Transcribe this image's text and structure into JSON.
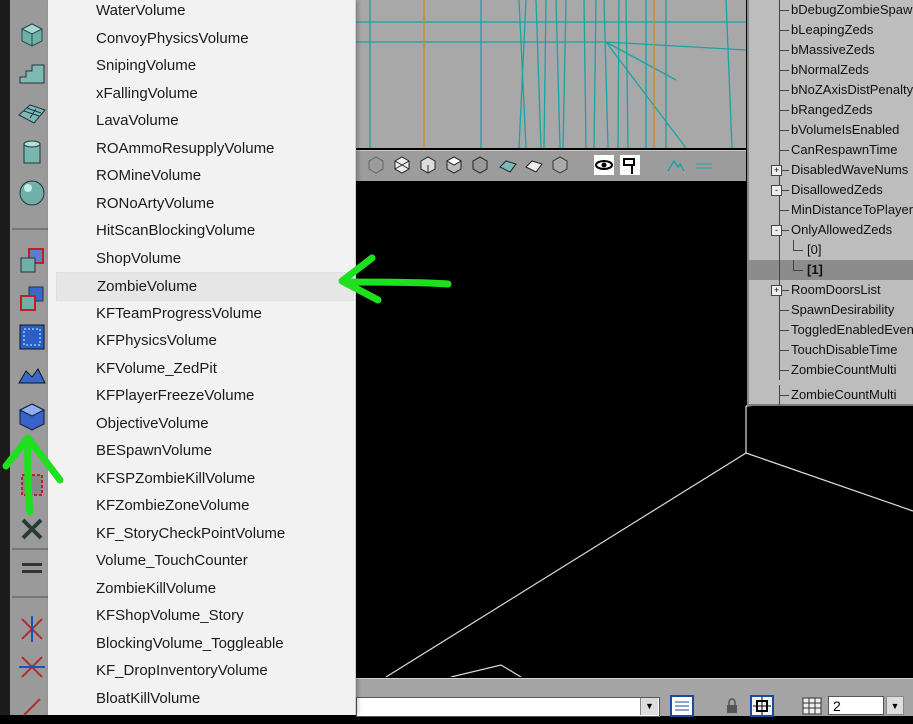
{
  "menu": {
    "items": [
      "WaterVolume",
      "ConvoyPhysicsVolume",
      "SnipingVolume",
      "xFallingVolume",
      "LavaVolume",
      "ROAmmoResupplyVolume",
      "ROMineVolume",
      "RONoArtyVolume",
      "HitScanBlockingVolume",
      "ShopVolume",
      "ZombieVolume",
      "KFTeamProgressVolume",
      "KFPhysicsVolume",
      "KFVolume_ZedPit",
      "KFPlayerFreezeVolume",
      "ObjectiveVolume",
      "BESpawnVolume",
      "KFSPZombieKillVolume",
      "KFZombieZoneVolume",
      "KF_StoryCheckPointVolume",
      "Volume_TouchCounter",
      "ZombieKillVolume",
      "KFShopVolume_Story",
      "BlockingVolume_Toggleable",
      "KF_DropInventoryVolume",
      "BloatKillVolume"
    ],
    "highlighted_index": 10
  },
  "properties": {
    "rows": [
      {
        "label": "bDebugZombieSpawning",
        "indent": 0
      },
      {
        "label": "bLeapingZeds",
        "indent": 0
      },
      {
        "label": "bMassiveZeds",
        "indent": 0
      },
      {
        "label": "bNormalZeds",
        "indent": 0
      },
      {
        "label": "bNoZAxisDistPenalty",
        "indent": 0
      },
      {
        "label": "bRangedZeds",
        "indent": 0
      },
      {
        "label": "bVolumeIsEnabled",
        "indent": 0
      },
      {
        "label": "CanRespawnTime",
        "indent": 0
      },
      {
        "label": "DisabledWaveNums",
        "indent": 0,
        "expander": "+"
      },
      {
        "label": "DisallowedZeds",
        "indent": 0,
        "expander": "-"
      },
      {
        "label": "MinDistanceToPlayer",
        "indent": 0
      },
      {
        "label": "OnlyAllowedZeds",
        "indent": 0,
        "expander": "-"
      },
      {
        "label": "[0]",
        "indent": 1
      },
      {
        "label": "[1]",
        "indent": 1,
        "selected": true
      },
      {
        "label": "RoomDoorsList",
        "indent": 0,
        "expander": "+"
      },
      {
        "label": "SpawnDesirability",
        "indent": 0
      },
      {
        "label": "ToggledEnabledEvent",
        "indent": 0
      },
      {
        "label": "TouchDisableTime",
        "indent": 0
      },
      {
        "label": "ZombieCountMulti",
        "indent": 0
      },
      {
        "label": "ZombieCountMulti",
        "indent": 0
      }
    ]
  },
  "statusbar": {
    "grid_value": "2"
  },
  "icons": {
    "toolbar": [
      "cube-icon",
      "stairs-icon",
      "terrain-icon",
      "cylinder-icon",
      "sphere-icon",
      "intersect-icon",
      "deintersect-icon",
      "add-brush-icon",
      "mover-icon",
      "volume-icon",
      "subtract-icon",
      "x-icon",
      "align-icon",
      "mirror-x-icon",
      "mirror-z-icon"
    ]
  },
  "colors": {
    "annotation": "#1fe01f",
    "wire_cyan": "#1aa3a3",
    "wire_orange": "#c78a2a"
  }
}
